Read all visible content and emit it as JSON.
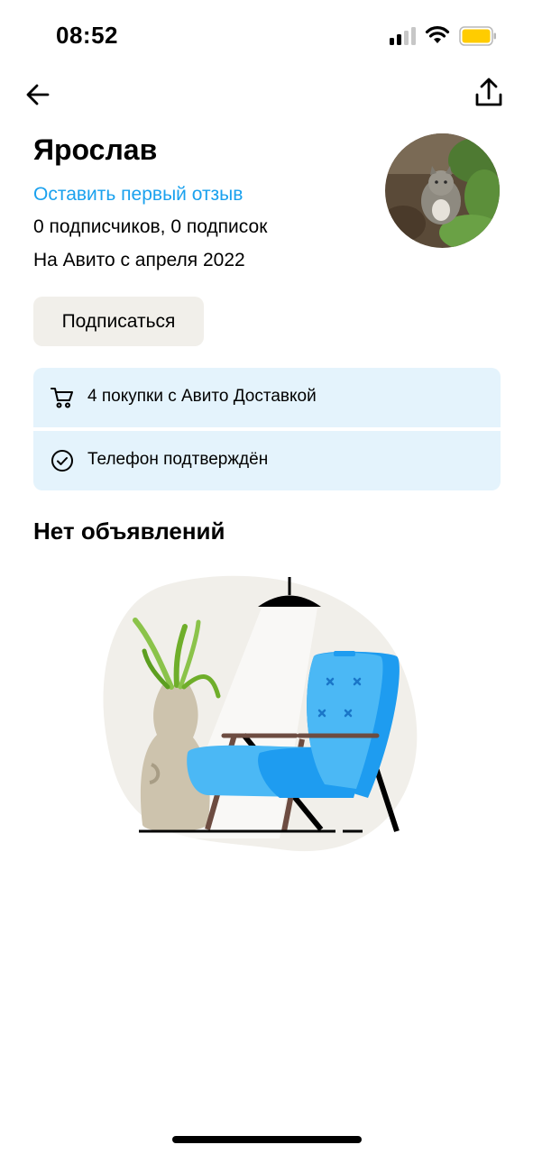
{
  "status_bar": {
    "time": "08:52"
  },
  "profile": {
    "name": "Ярослав",
    "review_link": "Оставить первый отзыв",
    "followers": "0 подписчиков, 0 подписок",
    "member_since": "На Авито с апреля 2022"
  },
  "subscribe_button": "Подписаться",
  "info": [
    {
      "icon": "cart-icon",
      "text": "4 покупки с Авито Доставкой"
    },
    {
      "icon": "check-circle-icon",
      "text": "Телефон подтверждён"
    }
  ],
  "listings": {
    "empty_title": "Нет объявлений"
  },
  "colors": {
    "accent_link": "#1aa1ee",
    "info_background": "#e4f3fc",
    "button_background": "#f1efea",
    "battery": "#ffcc00"
  }
}
